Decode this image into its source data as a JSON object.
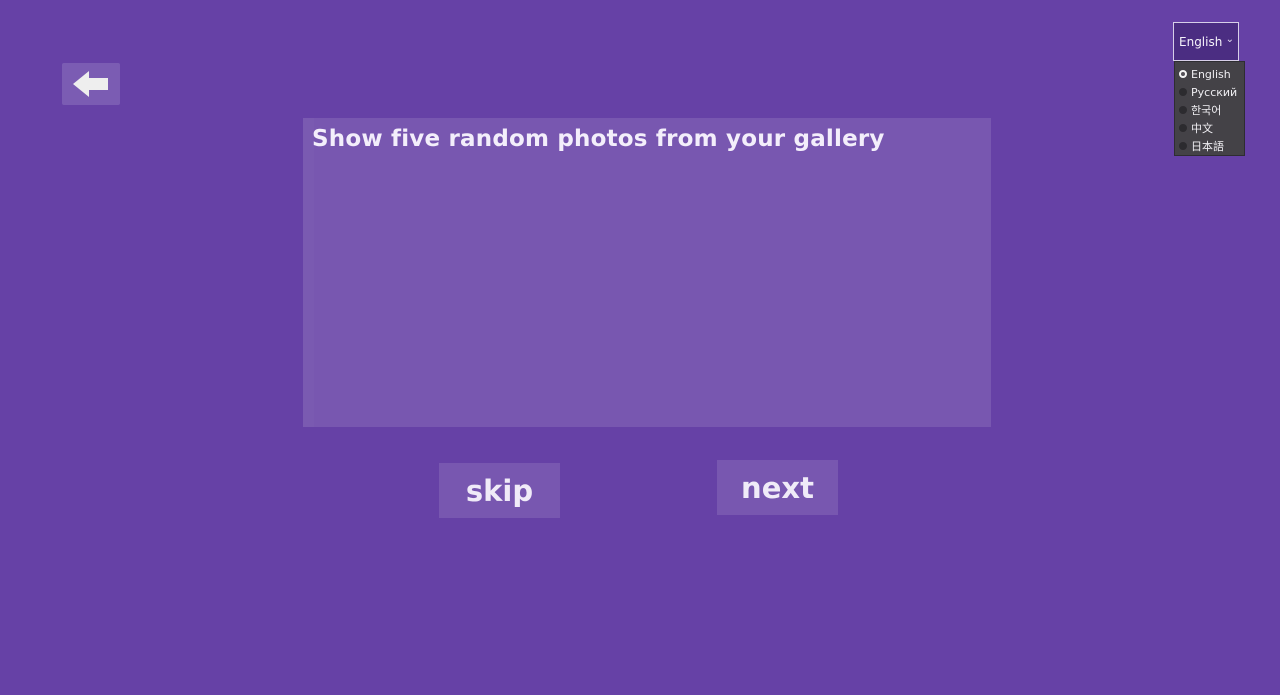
{
  "task": {
    "text": "Show five random photos from your gallery"
  },
  "buttons": {
    "skip_label": "skip",
    "next_label": "next"
  },
  "navigation": {
    "back_icon": "back-arrow-icon"
  },
  "language": {
    "selected_label": "English",
    "chevron_icon": "chevron-down-icon",
    "options": [
      {
        "label": "English",
        "selected": true
      },
      {
        "label": "Русский",
        "selected": false
      },
      {
        "label": "한국어",
        "selected": false
      },
      {
        "label": "中文",
        "selected": false
      },
      {
        "label": "日本語",
        "selected": false
      }
    ]
  },
  "colors": {
    "background": "#6641a6",
    "panel": "#7857b0",
    "accent_button": "#7b5cb3"
  }
}
